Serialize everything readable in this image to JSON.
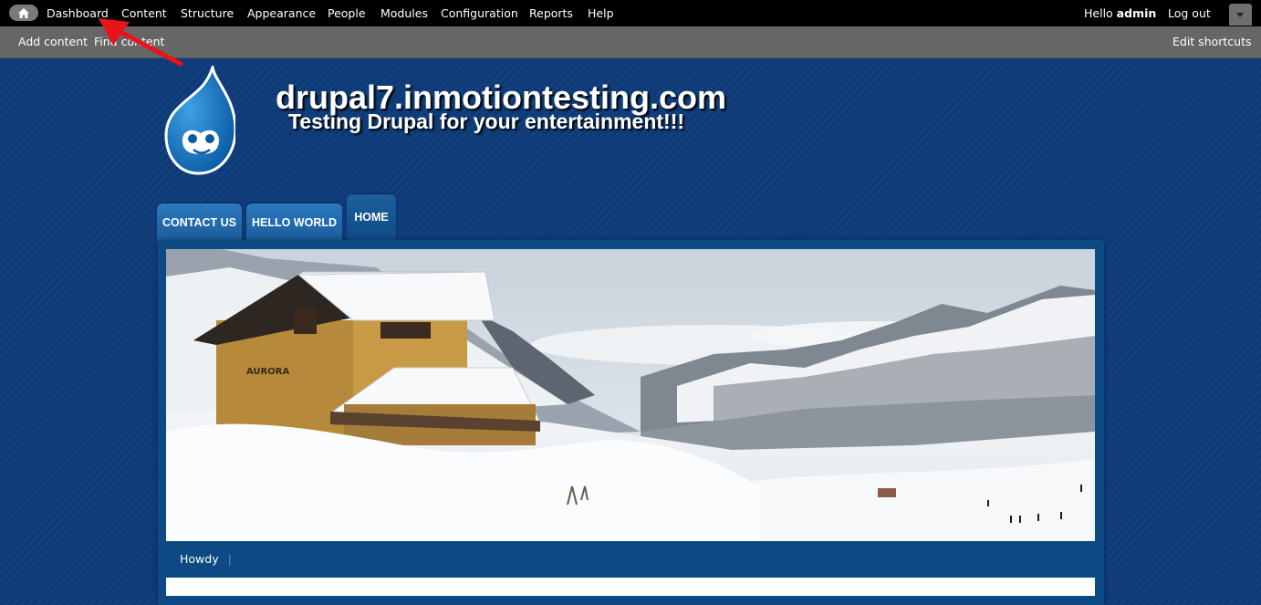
{
  "toolbar": {
    "menu": [
      {
        "label": "Dashboard"
      },
      {
        "label": "Content"
      },
      {
        "label": "Structure"
      },
      {
        "label": "Appearance"
      },
      {
        "label": "People"
      },
      {
        "label": "Modules"
      },
      {
        "label": "Configuration"
      },
      {
        "label": "Reports"
      },
      {
        "label": "Help"
      }
    ],
    "hello_prefix": "Hello",
    "user": "admin",
    "logout": "Log out",
    "home_icon": "home-icon",
    "drawer_icon": "chevron-down-icon"
  },
  "shortcuts": {
    "items": [
      {
        "label": "Add content"
      },
      {
        "label": "Find content"
      }
    ],
    "edit": "Edit shortcuts"
  },
  "site": {
    "name": "drupal7.inmotiontesting.com",
    "slogan": "Testing Drupal for your entertainment!!!",
    "logo_icon": "drupal-drop-logo"
  },
  "tabs": [
    {
      "label": "CONTACT US"
    },
    {
      "label": "HELLO WORLD"
    },
    {
      "label": "HOME",
      "active": true
    }
  ],
  "secondary_nav": {
    "items": [
      {
        "label": "Howdy"
      }
    ]
  },
  "colors": {
    "page_bg": "#0e3b78",
    "tab_blue": "#2c79bf",
    "annotation_arrow": "#e8141b"
  }
}
